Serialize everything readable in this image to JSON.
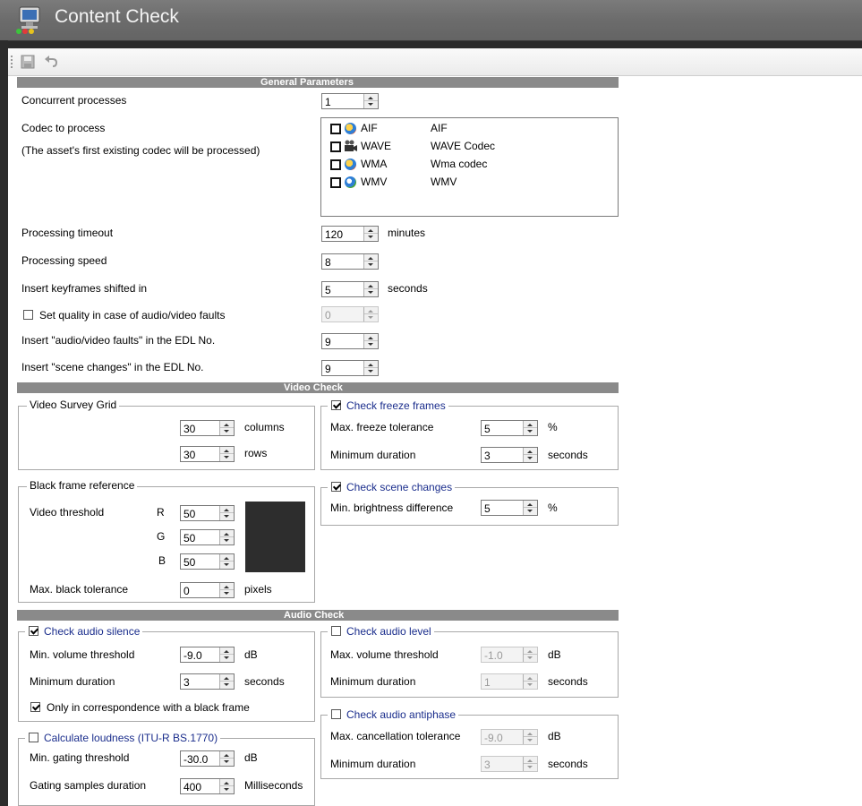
{
  "window": {
    "title": "Content Check"
  },
  "colors": {
    "title_bar": "#6c6c6c",
    "section_header": "#8a8a8a",
    "group_title_blue": "#1a2d8c",
    "black_swatch": "#2d2d2d"
  },
  "toolbar": {
    "save_icon": "save-icon",
    "undo_icon": "undo-icon"
  },
  "general": {
    "header": "General Parameters",
    "concurrent_label": "Concurrent processes",
    "concurrent_value": "1",
    "codec_label": "Codec to process",
    "codec_note": "(The asset's first existing codec will be processed)",
    "codecs": [
      {
        "name": "AIF",
        "desc": "AIF",
        "checked": false,
        "icon": "media-player-icon"
      },
      {
        "name": "WAVE",
        "desc": "WAVE Codec",
        "checked": false,
        "icon": "video-camera-icon"
      },
      {
        "name": "WMA",
        "desc": "Wma codec",
        "checked": false,
        "icon": "media-player-icon"
      },
      {
        "name": "WMV",
        "desc": "WMV",
        "checked": false,
        "icon": "media-player-icon"
      }
    ],
    "timeout_label": "Processing timeout",
    "timeout_value": "120",
    "timeout_unit": "minutes",
    "speed_label": "Processing speed",
    "speed_value": "8",
    "keyframes_label": "Insert keyframes shifted in",
    "keyframes_value": "5",
    "keyframes_unit": "seconds",
    "quality_label": "Set quality in case of audio/video faults",
    "quality_checked": false,
    "quality_value": "0",
    "faults_edl_label": "Insert \"audio/video faults\" in the EDL No.",
    "faults_edl_value": "9",
    "scene_edl_label": "Insert \"scene changes\" in the EDL No.",
    "scene_edl_value": "9"
  },
  "video": {
    "header": "Video Check",
    "grid": {
      "title": "Video Survey Grid",
      "columns_value": "30",
      "columns_unit": "columns",
      "rows_value": "30",
      "rows_unit": "rows"
    },
    "freeze": {
      "title": "Check freeze frames",
      "checked": true,
      "tolerance_label": "Max. freeze tolerance",
      "tolerance_value": "5",
      "tolerance_unit": "%",
      "duration_label": "Minimum duration",
      "duration_value": "3",
      "duration_unit": "seconds"
    },
    "black": {
      "title": "Black frame reference",
      "threshold_label": "Video threshold",
      "r_label": "R",
      "r_value": "50",
      "g_label": "G",
      "g_value": "50",
      "b_label": "B",
      "b_value": "50",
      "tolerance_label": "Max. black tolerance",
      "tolerance_value": "0",
      "tolerance_unit": "pixels"
    },
    "scene": {
      "title": "Check scene changes",
      "checked": true,
      "brightness_label": "Min. brightness difference",
      "brightness_value": "5",
      "brightness_unit": "%"
    }
  },
  "audio": {
    "header": "Audio Check",
    "silence": {
      "title": "Check audio silence",
      "checked": true,
      "volume_label": "Min. volume threshold",
      "volume_value": "-9.0",
      "volume_unit": "dB",
      "duration_label": "Minimum duration",
      "duration_value": "3",
      "duration_unit": "seconds",
      "black_only_label": "Only in correspondence with a black frame",
      "black_only_checked": true
    },
    "level": {
      "title": "Check audio level",
      "checked": false,
      "volume_label": "Max. volume threshold",
      "volume_value": "-1.0",
      "volume_unit": "dB",
      "duration_label": "Minimum duration",
      "duration_value": "1",
      "duration_unit": "seconds"
    },
    "antiphase": {
      "title": "Check audio antiphase",
      "checked": false,
      "tolerance_label": "Max. cancellation tolerance",
      "tolerance_value": "-9.0",
      "tolerance_unit": "dB",
      "duration_label": "Minimum duration",
      "duration_value": "3",
      "duration_unit": "seconds"
    },
    "loudness": {
      "title": "Calculate loudness (ITU-R BS.1770)",
      "checked": false,
      "gating_label": "Min. gating threshold",
      "gating_value": "-30.0",
      "gating_unit": "dB",
      "samples_label": "Gating samples duration",
      "samples_value": "400",
      "samples_unit": "Milliseconds"
    }
  }
}
